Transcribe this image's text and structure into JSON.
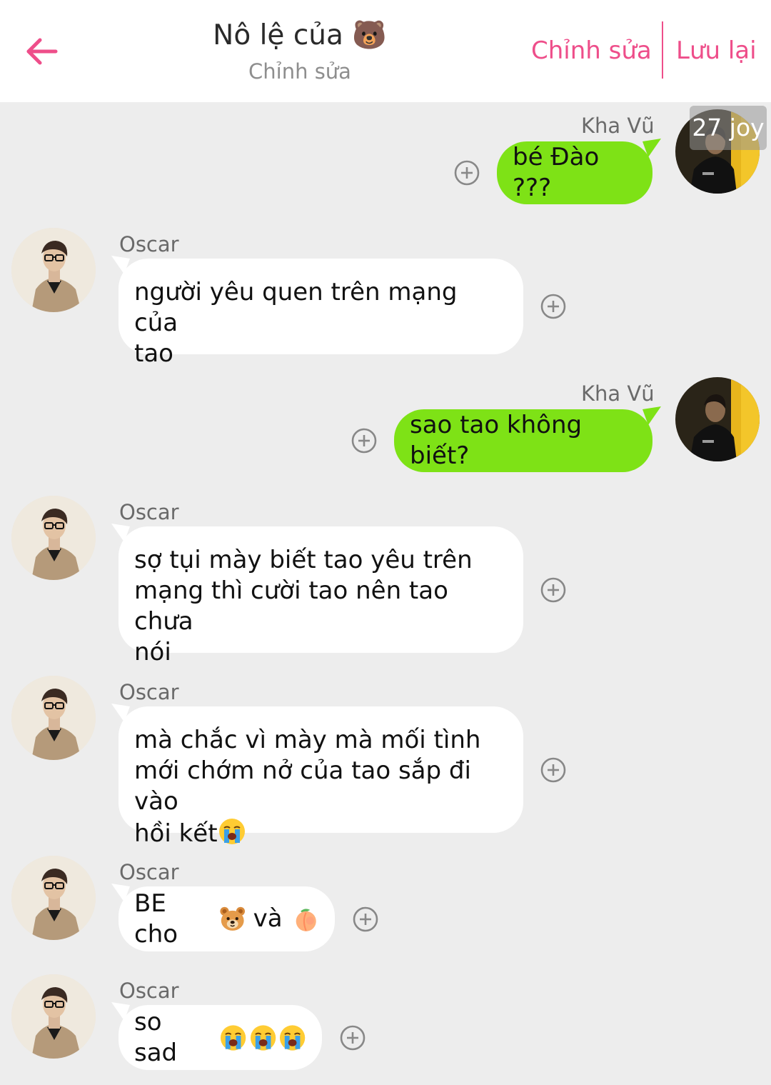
{
  "header": {
    "title": "Nô lệ của 🐻",
    "subtitle": "Chỉnh sửa",
    "edit_label": "Chỉnh sửa",
    "save_label": "Lưu lại",
    "accent_color": "#ee4e8a"
  },
  "badge": {
    "text": "27 joy"
  },
  "messages": [
    {
      "sender": "Kha Vũ",
      "side": "right",
      "text": "bé Đào ???"
    },
    {
      "sender": "Oscar",
      "side": "left",
      "lines": [
        "người yêu quen trên mạng của",
        "tao"
      ]
    },
    {
      "sender": "Kha Vũ",
      "side": "right",
      "text": "sao tao không biết?"
    },
    {
      "sender": "Oscar",
      "side": "left",
      "lines": [
        "sợ tụi mày biết tao yêu trên",
        "mạng thì cười tao nên tao chưa",
        "nói"
      ]
    },
    {
      "sender": "Oscar",
      "side": "left",
      "lines": [
        "mà chắc vì mày mà mối tình",
        "mới chớm nở của tao sắp đi vào",
        "hồi kết"
      ],
      "trailing_emoji": "crying-face"
    },
    {
      "sender": "Oscar",
      "side": "left",
      "text_parts": [
        "BE cho",
        "và"
      ],
      "emojis": [
        "bear-face",
        "peach"
      ]
    },
    {
      "sender": "Oscar",
      "side": "left",
      "text": "so sad",
      "emojis": [
        "crying-face",
        "crying-face",
        "crying-face"
      ]
    }
  ],
  "colors": {
    "sent_bubble": "#7ee216",
    "received_bubble": "#ffffff",
    "background": "#ededed"
  },
  "icons": {
    "back": "arrow-left-icon",
    "add_reaction": "plus-circle-icon"
  }
}
